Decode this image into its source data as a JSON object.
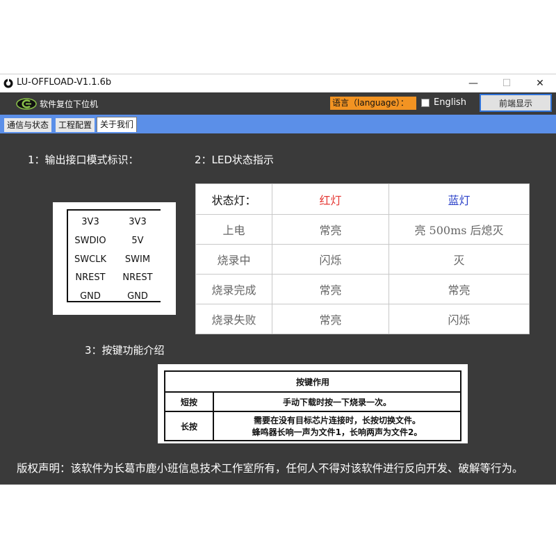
{
  "window": {
    "title": "LU-OFFLOAD-V1.1.6b",
    "minimize_glyph": "—",
    "maximize_glyph": "☐",
    "close_glyph": "✕"
  },
  "header": {
    "brand": "软件复位下位机",
    "language_label": "语言（language）：",
    "english_option": "English",
    "english_checked": false,
    "front_button": "前端显示"
  },
  "tabs": [
    {
      "label": "通信与状态",
      "active": false
    },
    {
      "label": "工程配置",
      "active": false
    },
    {
      "label": "关于我们",
      "active": true
    }
  ],
  "sections": {
    "interface_title": "1：输出接口模式标识：",
    "led_title": "2：LED状态指示",
    "key_title": "3：按键功能介绍"
  },
  "pins": {
    "left": [
      "3V3",
      "SWDIO",
      "SWCLK",
      "NREST",
      "GND"
    ],
    "right": [
      "3V3",
      "5V",
      "SWIM",
      "NREST",
      "GND"
    ]
  },
  "led_table": {
    "header": [
      "状态灯：",
      "红灯",
      "蓝灯"
    ],
    "rows": [
      [
        "上电",
        "常亮",
        "亮 500ms 后熄灭"
      ],
      [
        "烧录中",
        "闪烁",
        "灭"
      ],
      [
        "烧录完成",
        "常亮",
        "常亮"
      ],
      [
        "烧录失败",
        "常亮",
        "闪烁"
      ]
    ]
  },
  "key_table": {
    "title": "按键作用",
    "rows": [
      {
        "key": "短按",
        "desc": [
          "手动下载时按一下烧录一次。"
        ]
      },
      {
        "key": "长按",
        "desc": [
          "需要在没有目标芯片连接时，长按切换文件。",
          "蜂鸣器长响一声为文件1，长响两声为文件2。"
        ]
      }
    ]
  },
  "copyright": "版权声明：该软件为长葛市鹿小班信息技术工作室所有，任何人不得对该软件进行反向开发、破解等行为。",
  "colors": {
    "background_dark": "#3a3a3a",
    "tab_bar": "#5b8fe8",
    "language_badge": "#f29322",
    "red_led": "#e53935",
    "blue_led": "#2a40c8",
    "front_button_border": "#2f72d8"
  },
  "icons": {
    "app": "app-logo-icon",
    "brand": "brand-logo-icon"
  }
}
